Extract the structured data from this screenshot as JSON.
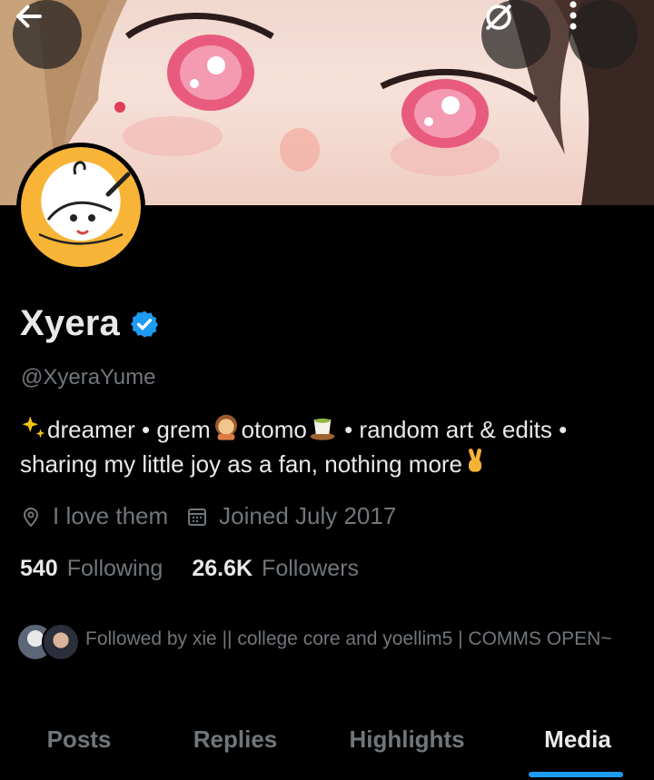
{
  "header": {
    "back_icon": "arrow-left-icon",
    "search_icon": "search-off-icon",
    "more_icon": "more-vertical-icon"
  },
  "profile": {
    "display_name": "Xyera",
    "verified": true,
    "handle": "@XyeraYume",
    "bio": {
      "line1_a": "dreamer • grem",
      "line1_b": "otomo",
      "line1_c": " • random art & edits •",
      "line2": "sharing my little joy as a fan, nothing more"
    },
    "location": "I love them",
    "joined": "Joined July 2017",
    "following_count": "540",
    "following_label": "Following",
    "followers_count": "26.6K",
    "followers_label": "Followers",
    "followed_by": "Followed by xie || college core and yoellim5 | COMMS OPEN~"
  },
  "tabs": [
    {
      "label": "Posts"
    },
    {
      "label": "Replies"
    },
    {
      "label": "Highlights"
    },
    {
      "label": "Media",
      "active": true
    }
  ],
  "colors": {
    "accent": "#1d9bf0",
    "muted_text": "#71767b",
    "primary_text": "#e7e9ea",
    "background": "#000000"
  }
}
